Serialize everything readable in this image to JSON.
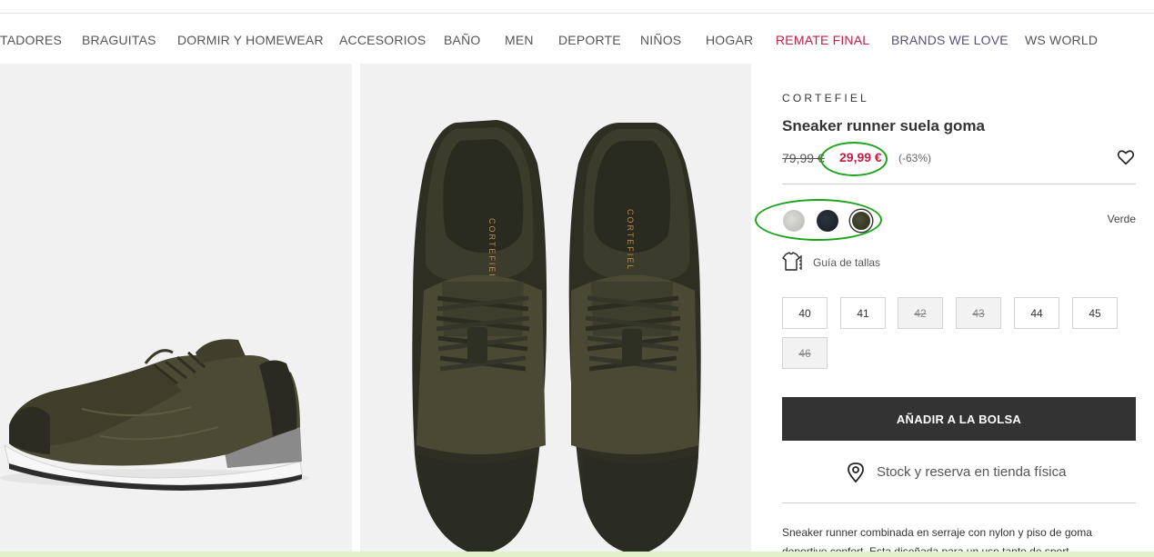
{
  "nav": {
    "items": [
      {
        "label": "TADORES",
        "color": "#555555"
      },
      {
        "label": "BRAGUITAS",
        "color": "#555555"
      },
      {
        "label": "DORMIR Y HOMEWEAR",
        "color": "#555555"
      },
      {
        "label": "ACCESORIOS",
        "color": "#555555"
      },
      {
        "label": "BAÑO",
        "color": "#555555"
      },
      {
        "label": "MEN",
        "color": "#555555"
      },
      {
        "label": "DEPORTE",
        "color": "#555555"
      },
      {
        "label": "NIÑOS",
        "color": "#555555"
      },
      {
        "label": "HOGAR",
        "color": "#555555"
      },
      {
        "label": "REMATE FINAL",
        "color": "#c41c45"
      },
      {
        "label": "BRANDS WE LOVE",
        "color": "#5a4f7a"
      },
      {
        "label": "WS WORLD",
        "color": "#555555"
      }
    ]
  },
  "gallery": {
    "photo_1": {
      "icon": "sneaker-side-photo"
    },
    "photo_2": {
      "icon": "sneaker-top-photo",
      "insole_text": "CORTEFIEL"
    }
  },
  "product": {
    "brand": "CORTEFIEL",
    "title": "Sneaker runner suela goma",
    "old_price": "79,99 €",
    "new_price": "29,99 €",
    "discount": "(-63%)",
    "selected_color": "Verde",
    "size_guide_label": "Guía de tallas",
    "sizes": [
      {
        "label": "40",
        "available": true
      },
      {
        "label": "41",
        "available": true
      },
      {
        "label": "42",
        "available": false
      },
      {
        "label": "43",
        "available": false
      },
      {
        "label": "44",
        "available": true
      },
      {
        "label": "45",
        "available": true
      },
      {
        "label": "46",
        "available": false
      }
    ],
    "add_to_bag_label": "AÑADIR A LA BOLSA",
    "stock_label": "Stock y reserva en tienda física",
    "description": "Sneaker runner combinada en serraje con nylon y piso de goma deportivo confort. Esta diseñada para un uso tanto de sport"
  },
  "colors": {
    "accent_price": "#c41c45",
    "button_bg": "#333333",
    "annotation_circle": "#1ba31b"
  }
}
